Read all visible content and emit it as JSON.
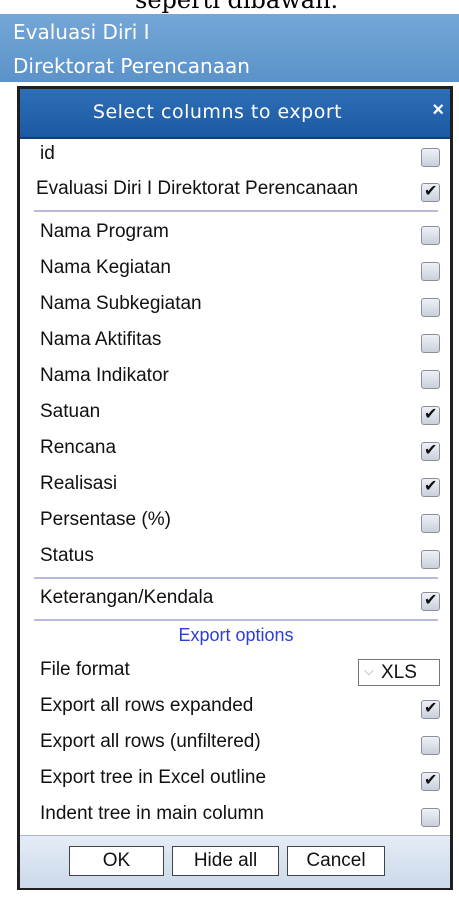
{
  "page_top_text": "seperti dibawah.",
  "background_header": {
    "line1": "Evaluasi Diri I",
    "line2": "Direktorat Perencanaan"
  },
  "dialog": {
    "title": "Select columns to export",
    "close_label": "×"
  },
  "columns": [
    {
      "label": "id",
      "checked": false
    },
    {
      "label": "Evaluasi Diri I Direktorat Perencanaan",
      "checked": true
    },
    {
      "label": "Nama Program",
      "checked": false
    },
    {
      "label": "Nama Kegiatan",
      "checked": false
    },
    {
      "label": "Nama Subkegiatan",
      "checked": false
    },
    {
      "label": "Nama Aktifitas",
      "checked": false
    },
    {
      "label": "Nama Indikator",
      "checked": false
    },
    {
      "label": "Satuan",
      "checked": true
    },
    {
      "label": "Rencana",
      "checked": true
    },
    {
      "label": "Realisasi",
      "checked": true
    },
    {
      "label": "Persentase (%)",
      "checked": false
    },
    {
      "label": "Status",
      "checked": false
    },
    {
      "label": "Keterangan/Kendala",
      "checked": true
    }
  ],
  "export_options": {
    "title": "Export options",
    "file_format_label": "File format",
    "file_format_value": "XLS",
    "options": [
      {
        "label": "Export all rows expanded",
        "checked": true
      },
      {
        "label": "Export all rows (unfiltered)",
        "checked": false
      },
      {
        "label": "Export tree in Excel outline",
        "checked": true
      },
      {
        "label": "Indent tree in main column",
        "checked": false
      }
    ]
  },
  "buttons": {
    "ok": "OK",
    "hide_all": "Hide all",
    "cancel": "Cancel"
  }
}
